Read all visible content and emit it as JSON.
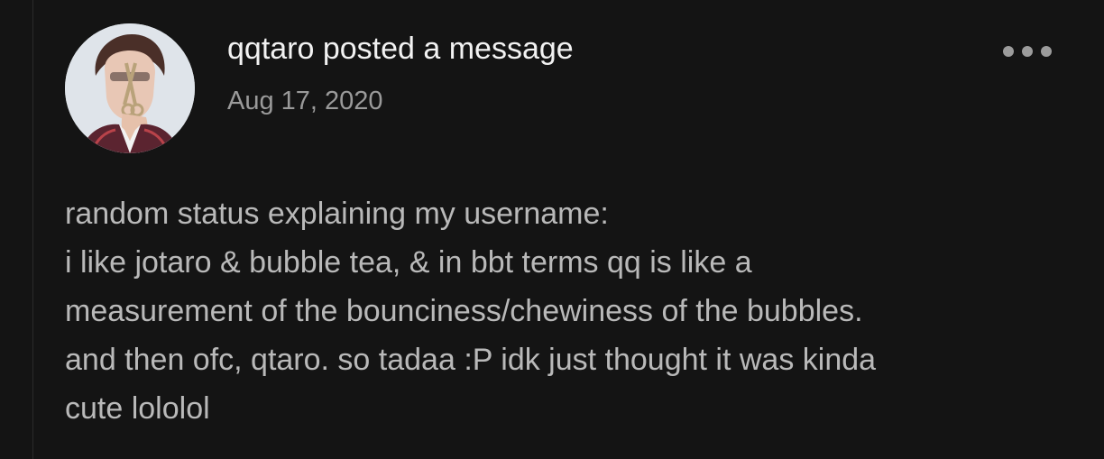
{
  "post": {
    "author_line": "qqtaro posted a message",
    "date": "Aug 17, 2020",
    "more_icon": "more-horizontal-icon",
    "body_lines": [
      "random status explaining my username:",
      "i like jotaro & bubble tea, & in bbt terms qq is like a",
      "measurement of the bounciness/chewiness of the bubbles.",
      "and then ofc, qtaro. so tadaa :P idk just thought it was kinda",
      "cute lololol"
    ]
  },
  "colors": {
    "background": "#141414",
    "author_text": "#f2f2f2",
    "meta_text": "#9a9a9a",
    "body_text": "#b9b9b9",
    "dots": "#9c9c9c"
  }
}
